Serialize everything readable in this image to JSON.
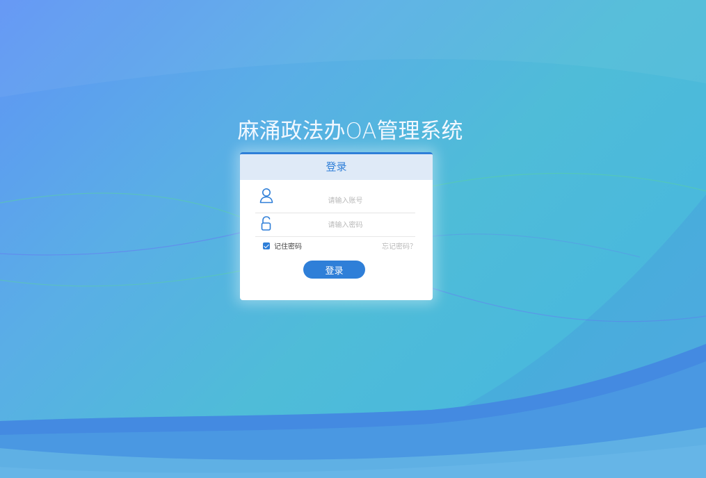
{
  "page": {
    "title": "麻涌政法办OA管理系统"
  },
  "login_card": {
    "header": "登录",
    "username_placeholder": "请输入账号",
    "password_placeholder": "请输入密码",
    "remember_label": "记住密码",
    "remember_checked": true,
    "forgot_label": "忘记密码？",
    "submit_label": "登录"
  },
  "colors": {
    "accent": "#2f7fd8",
    "header_bg": "#dfeaf7",
    "bg_start": "#5f94f5",
    "bg_end": "#4ab9dc"
  },
  "icons": {
    "username": "user-icon",
    "password": "unlock-icon",
    "remember": "checkbox-checked-icon"
  }
}
